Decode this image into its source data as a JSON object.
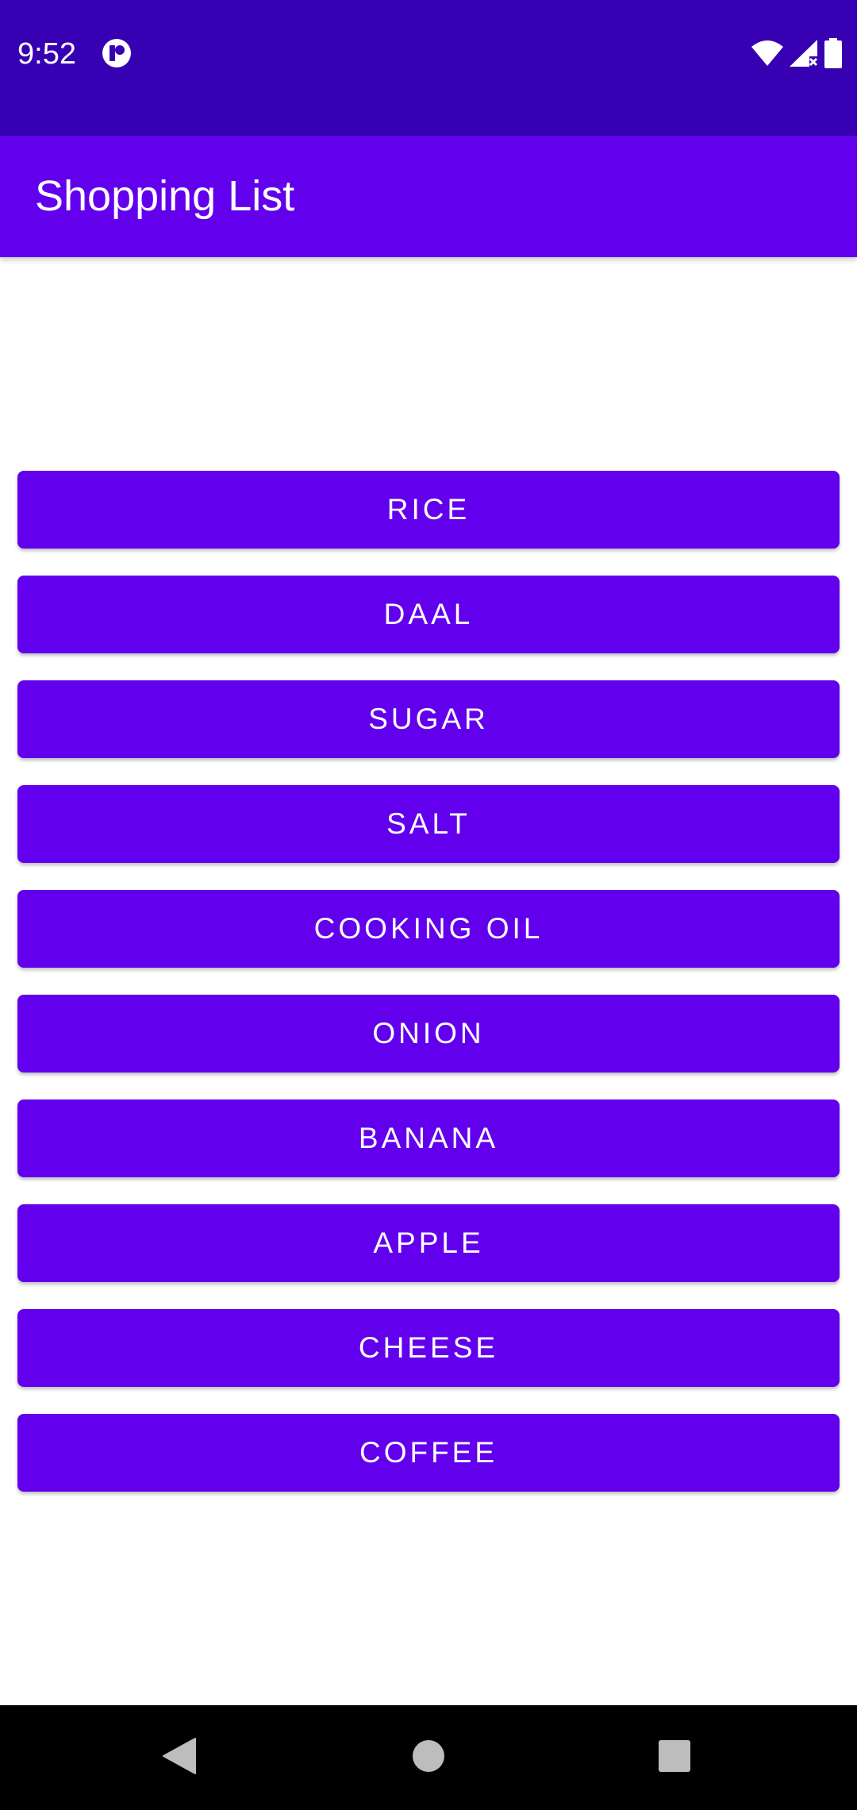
{
  "status_bar": {
    "time": "9:52",
    "app_icon": "notification-app-icon",
    "icons": [
      "wifi-icon",
      "signal-icon",
      "battery-icon"
    ],
    "color": "#3700b3"
  },
  "app_bar": {
    "title": "Shopping List",
    "color": "#6200ee"
  },
  "items": [
    {
      "label": "RICE"
    },
    {
      "label": "DAAL"
    },
    {
      "label": "SUGAR"
    },
    {
      "label": "SALT"
    },
    {
      "label": "COOKING OIL"
    },
    {
      "label": "ONION"
    },
    {
      "label": "BANANA"
    },
    {
      "label": "APPLE"
    },
    {
      "label": "CHEESE"
    },
    {
      "label": "COFFEE"
    }
  ],
  "button_color": "#6200ee",
  "nav_bar": {
    "buttons": [
      "back-icon",
      "home-icon",
      "recents-icon"
    ]
  }
}
